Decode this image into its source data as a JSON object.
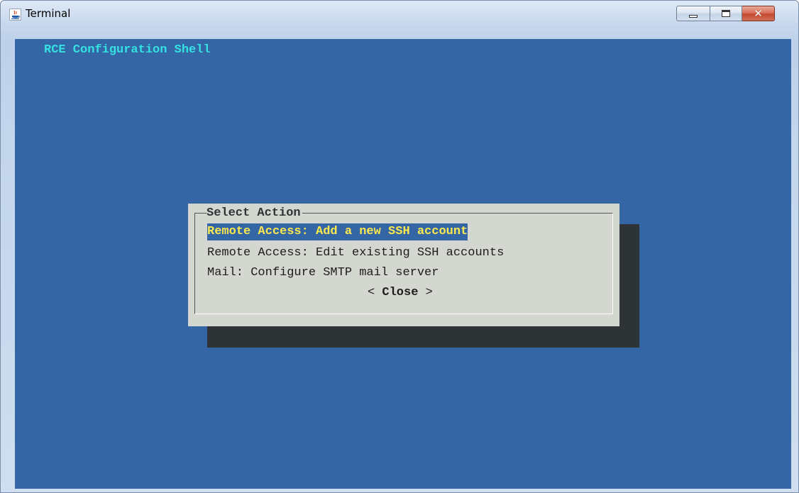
{
  "window": {
    "title": "Terminal",
    "title_icon": "java-icon"
  },
  "terminal": {
    "header": "RCE Configuration Shell",
    "dialog": {
      "title": "Select Action",
      "items": [
        {
          "label": "Remote Access: Add a new SSH account",
          "selected": true
        },
        {
          "label": "Remote Access: Edit existing SSH accounts",
          "selected": false
        },
        {
          "label": "Mail: Configure SMTP mail server",
          "selected": false
        }
      ],
      "close_left": "< ",
      "close_label": "Close",
      "close_right": " >"
    }
  },
  "colors": {
    "terminal_bg": "#3465a4",
    "header_text": "#34e2e2",
    "dialog_bg": "#d3d7cf",
    "shadow": "#2e3436",
    "highlight_text": "#fce94f"
  }
}
